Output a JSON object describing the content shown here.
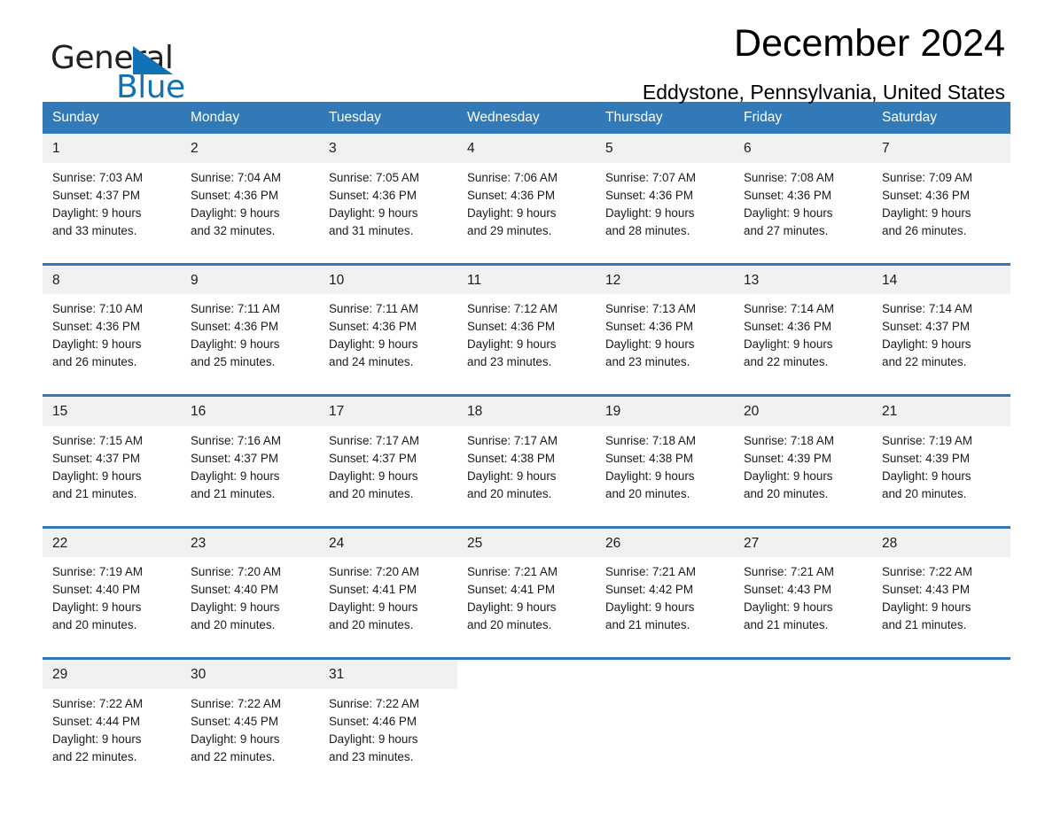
{
  "brand": {
    "name_part1": "General",
    "name_part2": "Blue",
    "logo_color": "#1272b6"
  },
  "header": {
    "month_title": "December 2024",
    "location": "Eddystone, Pennsylvania, United States"
  },
  "calendar": {
    "header_bg": "#3279b7",
    "daynum_bg": "#f1f1f1",
    "weekday_headers": [
      "Sunday",
      "Monday",
      "Tuesday",
      "Wednesday",
      "Thursday",
      "Friday",
      "Saturday"
    ],
    "weeks": [
      [
        {
          "day": "1",
          "sunrise": "Sunrise: 7:03 AM",
          "sunset": "Sunset: 4:37 PM",
          "daylight_line1": "Daylight: 9 hours",
          "daylight_line2": "and 33 minutes."
        },
        {
          "day": "2",
          "sunrise": "Sunrise: 7:04 AM",
          "sunset": "Sunset: 4:36 PM",
          "daylight_line1": "Daylight: 9 hours",
          "daylight_line2": "and 32 minutes."
        },
        {
          "day": "3",
          "sunrise": "Sunrise: 7:05 AM",
          "sunset": "Sunset: 4:36 PM",
          "daylight_line1": "Daylight: 9 hours",
          "daylight_line2": "and 31 minutes."
        },
        {
          "day": "4",
          "sunrise": "Sunrise: 7:06 AM",
          "sunset": "Sunset: 4:36 PM",
          "daylight_line1": "Daylight: 9 hours",
          "daylight_line2": "and 29 minutes."
        },
        {
          "day": "5",
          "sunrise": "Sunrise: 7:07 AM",
          "sunset": "Sunset: 4:36 PM",
          "daylight_line1": "Daylight: 9 hours",
          "daylight_line2": "and 28 minutes."
        },
        {
          "day": "6",
          "sunrise": "Sunrise: 7:08 AM",
          "sunset": "Sunset: 4:36 PM",
          "daylight_line1": "Daylight: 9 hours",
          "daylight_line2": "and 27 minutes."
        },
        {
          "day": "7",
          "sunrise": "Sunrise: 7:09 AM",
          "sunset": "Sunset: 4:36 PM",
          "daylight_line1": "Daylight: 9 hours",
          "daylight_line2": "and 26 minutes."
        }
      ],
      [
        {
          "day": "8",
          "sunrise": "Sunrise: 7:10 AM",
          "sunset": "Sunset: 4:36 PM",
          "daylight_line1": "Daylight: 9 hours",
          "daylight_line2": "and 26 minutes."
        },
        {
          "day": "9",
          "sunrise": "Sunrise: 7:11 AM",
          "sunset": "Sunset: 4:36 PM",
          "daylight_line1": "Daylight: 9 hours",
          "daylight_line2": "and 25 minutes."
        },
        {
          "day": "10",
          "sunrise": "Sunrise: 7:11 AM",
          "sunset": "Sunset: 4:36 PM",
          "daylight_line1": "Daylight: 9 hours",
          "daylight_line2": "and 24 minutes."
        },
        {
          "day": "11",
          "sunrise": "Sunrise: 7:12 AM",
          "sunset": "Sunset: 4:36 PM",
          "daylight_line1": "Daylight: 9 hours",
          "daylight_line2": "and 23 minutes."
        },
        {
          "day": "12",
          "sunrise": "Sunrise: 7:13 AM",
          "sunset": "Sunset: 4:36 PM",
          "daylight_line1": "Daylight: 9 hours",
          "daylight_line2": "and 23 minutes."
        },
        {
          "day": "13",
          "sunrise": "Sunrise: 7:14 AM",
          "sunset": "Sunset: 4:36 PM",
          "daylight_line1": "Daylight: 9 hours",
          "daylight_line2": "and 22 minutes."
        },
        {
          "day": "14",
          "sunrise": "Sunrise: 7:14 AM",
          "sunset": "Sunset: 4:37 PM",
          "daylight_line1": "Daylight: 9 hours",
          "daylight_line2": "and 22 minutes."
        }
      ],
      [
        {
          "day": "15",
          "sunrise": "Sunrise: 7:15 AM",
          "sunset": "Sunset: 4:37 PM",
          "daylight_line1": "Daylight: 9 hours",
          "daylight_line2": "and 21 minutes."
        },
        {
          "day": "16",
          "sunrise": "Sunrise: 7:16 AM",
          "sunset": "Sunset: 4:37 PM",
          "daylight_line1": "Daylight: 9 hours",
          "daylight_line2": "and 21 minutes."
        },
        {
          "day": "17",
          "sunrise": "Sunrise: 7:17 AM",
          "sunset": "Sunset: 4:37 PM",
          "daylight_line1": "Daylight: 9 hours",
          "daylight_line2": "and 20 minutes."
        },
        {
          "day": "18",
          "sunrise": "Sunrise: 7:17 AM",
          "sunset": "Sunset: 4:38 PM",
          "daylight_line1": "Daylight: 9 hours",
          "daylight_line2": "and 20 minutes."
        },
        {
          "day": "19",
          "sunrise": "Sunrise: 7:18 AM",
          "sunset": "Sunset: 4:38 PM",
          "daylight_line1": "Daylight: 9 hours",
          "daylight_line2": "and 20 minutes."
        },
        {
          "day": "20",
          "sunrise": "Sunrise: 7:18 AM",
          "sunset": "Sunset: 4:39 PM",
          "daylight_line1": "Daylight: 9 hours",
          "daylight_line2": "and 20 minutes."
        },
        {
          "day": "21",
          "sunrise": "Sunrise: 7:19 AM",
          "sunset": "Sunset: 4:39 PM",
          "daylight_line1": "Daylight: 9 hours",
          "daylight_line2": "and 20 minutes."
        }
      ],
      [
        {
          "day": "22",
          "sunrise": "Sunrise: 7:19 AM",
          "sunset": "Sunset: 4:40 PM",
          "daylight_line1": "Daylight: 9 hours",
          "daylight_line2": "and 20 minutes."
        },
        {
          "day": "23",
          "sunrise": "Sunrise: 7:20 AM",
          "sunset": "Sunset: 4:40 PM",
          "daylight_line1": "Daylight: 9 hours",
          "daylight_line2": "and 20 minutes."
        },
        {
          "day": "24",
          "sunrise": "Sunrise: 7:20 AM",
          "sunset": "Sunset: 4:41 PM",
          "daylight_line1": "Daylight: 9 hours",
          "daylight_line2": "and 20 minutes."
        },
        {
          "day": "25",
          "sunrise": "Sunrise: 7:21 AM",
          "sunset": "Sunset: 4:41 PM",
          "daylight_line1": "Daylight: 9 hours",
          "daylight_line2": "and 20 minutes."
        },
        {
          "day": "26",
          "sunrise": "Sunrise: 7:21 AM",
          "sunset": "Sunset: 4:42 PM",
          "daylight_line1": "Daylight: 9 hours",
          "daylight_line2": "and 21 minutes."
        },
        {
          "day": "27",
          "sunrise": "Sunrise: 7:21 AM",
          "sunset": "Sunset: 4:43 PM",
          "daylight_line1": "Daylight: 9 hours",
          "daylight_line2": "and 21 minutes."
        },
        {
          "day": "28",
          "sunrise": "Sunrise: 7:22 AM",
          "sunset": "Sunset: 4:43 PM",
          "daylight_line1": "Daylight: 9 hours",
          "daylight_line2": "and 21 minutes."
        }
      ],
      [
        {
          "day": "29",
          "sunrise": "Sunrise: 7:22 AM",
          "sunset": "Sunset: 4:44 PM",
          "daylight_line1": "Daylight: 9 hours",
          "daylight_line2": "and 22 minutes."
        },
        {
          "day": "30",
          "sunrise": "Sunrise: 7:22 AM",
          "sunset": "Sunset: 4:45 PM",
          "daylight_line1": "Daylight: 9 hours",
          "daylight_line2": "and 22 minutes."
        },
        {
          "day": "31",
          "sunrise": "Sunrise: 7:22 AM",
          "sunset": "Sunset: 4:46 PM",
          "daylight_line1": "Daylight: 9 hours",
          "daylight_line2": "and 23 minutes."
        },
        {
          "day": "",
          "sunrise": "",
          "sunset": "",
          "daylight_line1": "",
          "daylight_line2": ""
        },
        {
          "day": "",
          "sunrise": "",
          "sunset": "",
          "daylight_line1": "",
          "daylight_line2": ""
        },
        {
          "day": "",
          "sunrise": "",
          "sunset": "",
          "daylight_line1": "",
          "daylight_line2": ""
        },
        {
          "day": "",
          "sunrise": "",
          "sunset": "",
          "daylight_line1": "",
          "daylight_line2": ""
        }
      ]
    ]
  }
}
